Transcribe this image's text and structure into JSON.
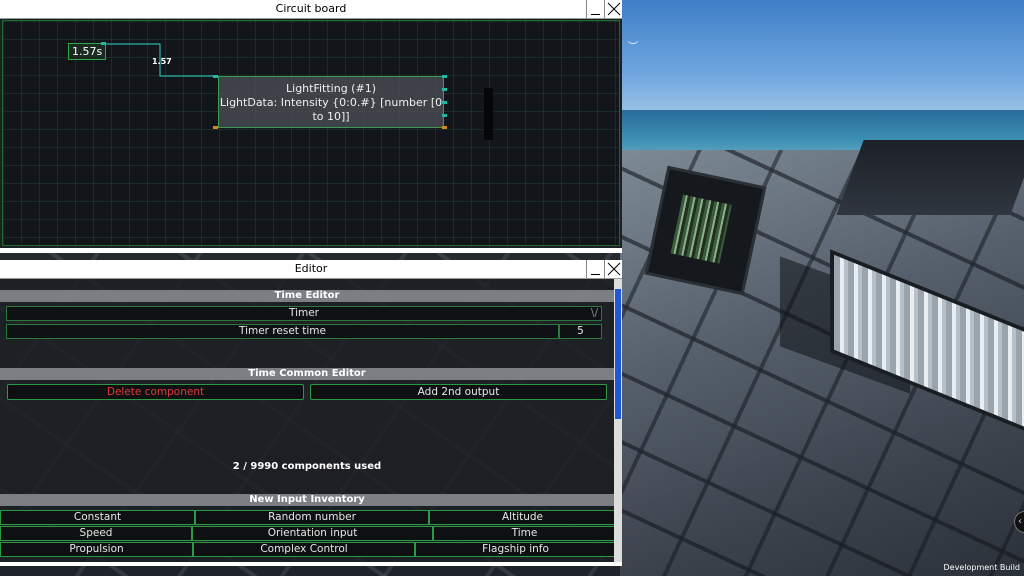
{
  "circuit_window": {
    "title": "Circuit board",
    "timer_node_label": "1.57s",
    "wire_value": "1.57",
    "light_node": {
      "title": "LightFitting (#1)",
      "subtitle": "LightData: Intensity {0:0.#} [number [0 to 10]]"
    }
  },
  "editor_window": {
    "title": "Editor",
    "time_editor": {
      "header": "Time Editor",
      "timer_label": "Timer",
      "timer_value": "\\/",
      "reset_label": "Timer reset time",
      "reset_value": "5"
    },
    "time_common_editor": {
      "header": "Time Common Editor",
      "delete_label": "Delete component",
      "add_output_label": "Add 2nd output"
    },
    "usage_text": "2 / 9990 components used",
    "inventory": {
      "header": "New Input Inventory",
      "row1": [
        "Constant",
        "Random number",
        "Altitude"
      ],
      "row2": [
        "Speed",
        "Orientation input",
        "Time"
      ],
      "row3": [
        "Propulsion",
        "Complex Control",
        "Flagship info"
      ]
    }
  },
  "game": {
    "build_label": "Development Build",
    "edge_button_glyph": "‹"
  },
  "colors": {
    "accent_green": "#2c9a45",
    "danger_red": "#e03a3a",
    "scroll_blue": "#1e58d8"
  }
}
